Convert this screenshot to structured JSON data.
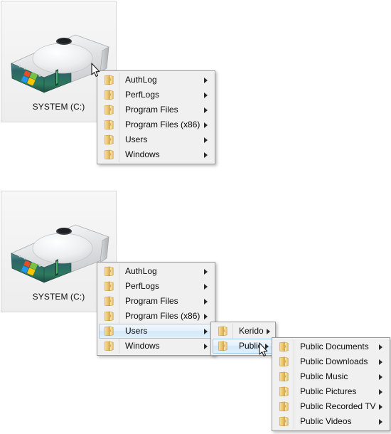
{
  "desktop": {
    "drive_icon": {
      "name": "hard-disk-drive-icon",
      "label": "SYSTEM (C:)"
    }
  },
  "colors": {
    "menu_background": "#f0f0f0",
    "menu_border": "#9b9b9b",
    "menu_text": "#0a0a0a",
    "highlight_border": "#9ec9e8",
    "highlight_fill": "#d3e8f8",
    "separator": "#d9d9d9",
    "folder_gold": "#f0c868",
    "icon_box_background": "#f2f2f2",
    "icon_box_border": "#d8d8d8"
  },
  "icons": {
    "folder": "folder-icon",
    "submenu_arrow": "chevron-right-icon",
    "cursor": "mouse-pointer-icon"
  },
  "scenes": [
    {
      "id": "scene-top",
      "drive_label": "SYSTEM (C:)",
      "menus": [
        {
          "id": "root-menu",
          "items": [
            {
              "label": "AuthLog",
              "has_submenu": true,
              "selected": false
            },
            {
              "label": "PerfLogs",
              "has_submenu": true,
              "selected": false
            },
            {
              "label": "Program Files",
              "has_submenu": true,
              "selected": false
            },
            {
              "label": "Program Files (x86)",
              "has_submenu": true,
              "selected": false
            },
            {
              "label": "Users",
              "has_submenu": true,
              "selected": false
            },
            {
              "label": "Windows",
              "has_submenu": true,
              "selected": false
            }
          ]
        }
      ]
    },
    {
      "id": "scene-bottom",
      "drive_label": "SYSTEM (C:)",
      "menus": [
        {
          "id": "root-menu-2",
          "items": [
            {
              "label": "AuthLog",
              "has_submenu": true,
              "selected": false
            },
            {
              "label": "PerfLogs",
              "has_submenu": true,
              "selected": false
            },
            {
              "label": "Program Files",
              "has_submenu": true,
              "selected": false
            },
            {
              "label": "Program Files (x86)",
              "has_submenu": true,
              "selected": false
            },
            {
              "label": "Users",
              "has_submenu": true,
              "selected": true
            },
            {
              "label": "Windows",
              "has_submenu": true,
              "selected": false
            }
          ]
        },
        {
          "id": "users-submenu",
          "items": [
            {
              "label": "Kerido",
              "has_submenu": true,
              "selected": false
            },
            {
              "label": "Public",
              "has_submenu": true,
              "selected": true
            }
          ]
        },
        {
          "id": "public-submenu",
          "items": [
            {
              "label": "Public Documents",
              "has_submenu": true,
              "selected": false
            },
            {
              "label": "Public Downloads",
              "has_submenu": true,
              "selected": false
            },
            {
              "label": "Public Music",
              "has_submenu": true,
              "selected": false
            },
            {
              "label": "Public Pictures",
              "has_submenu": true,
              "selected": false
            },
            {
              "label": "Public Recorded TV",
              "has_submenu": true,
              "selected": false
            },
            {
              "label": "Public Videos",
              "has_submenu": true,
              "selected": false
            }
          ]
        }
      ]
    }
  ]
}
